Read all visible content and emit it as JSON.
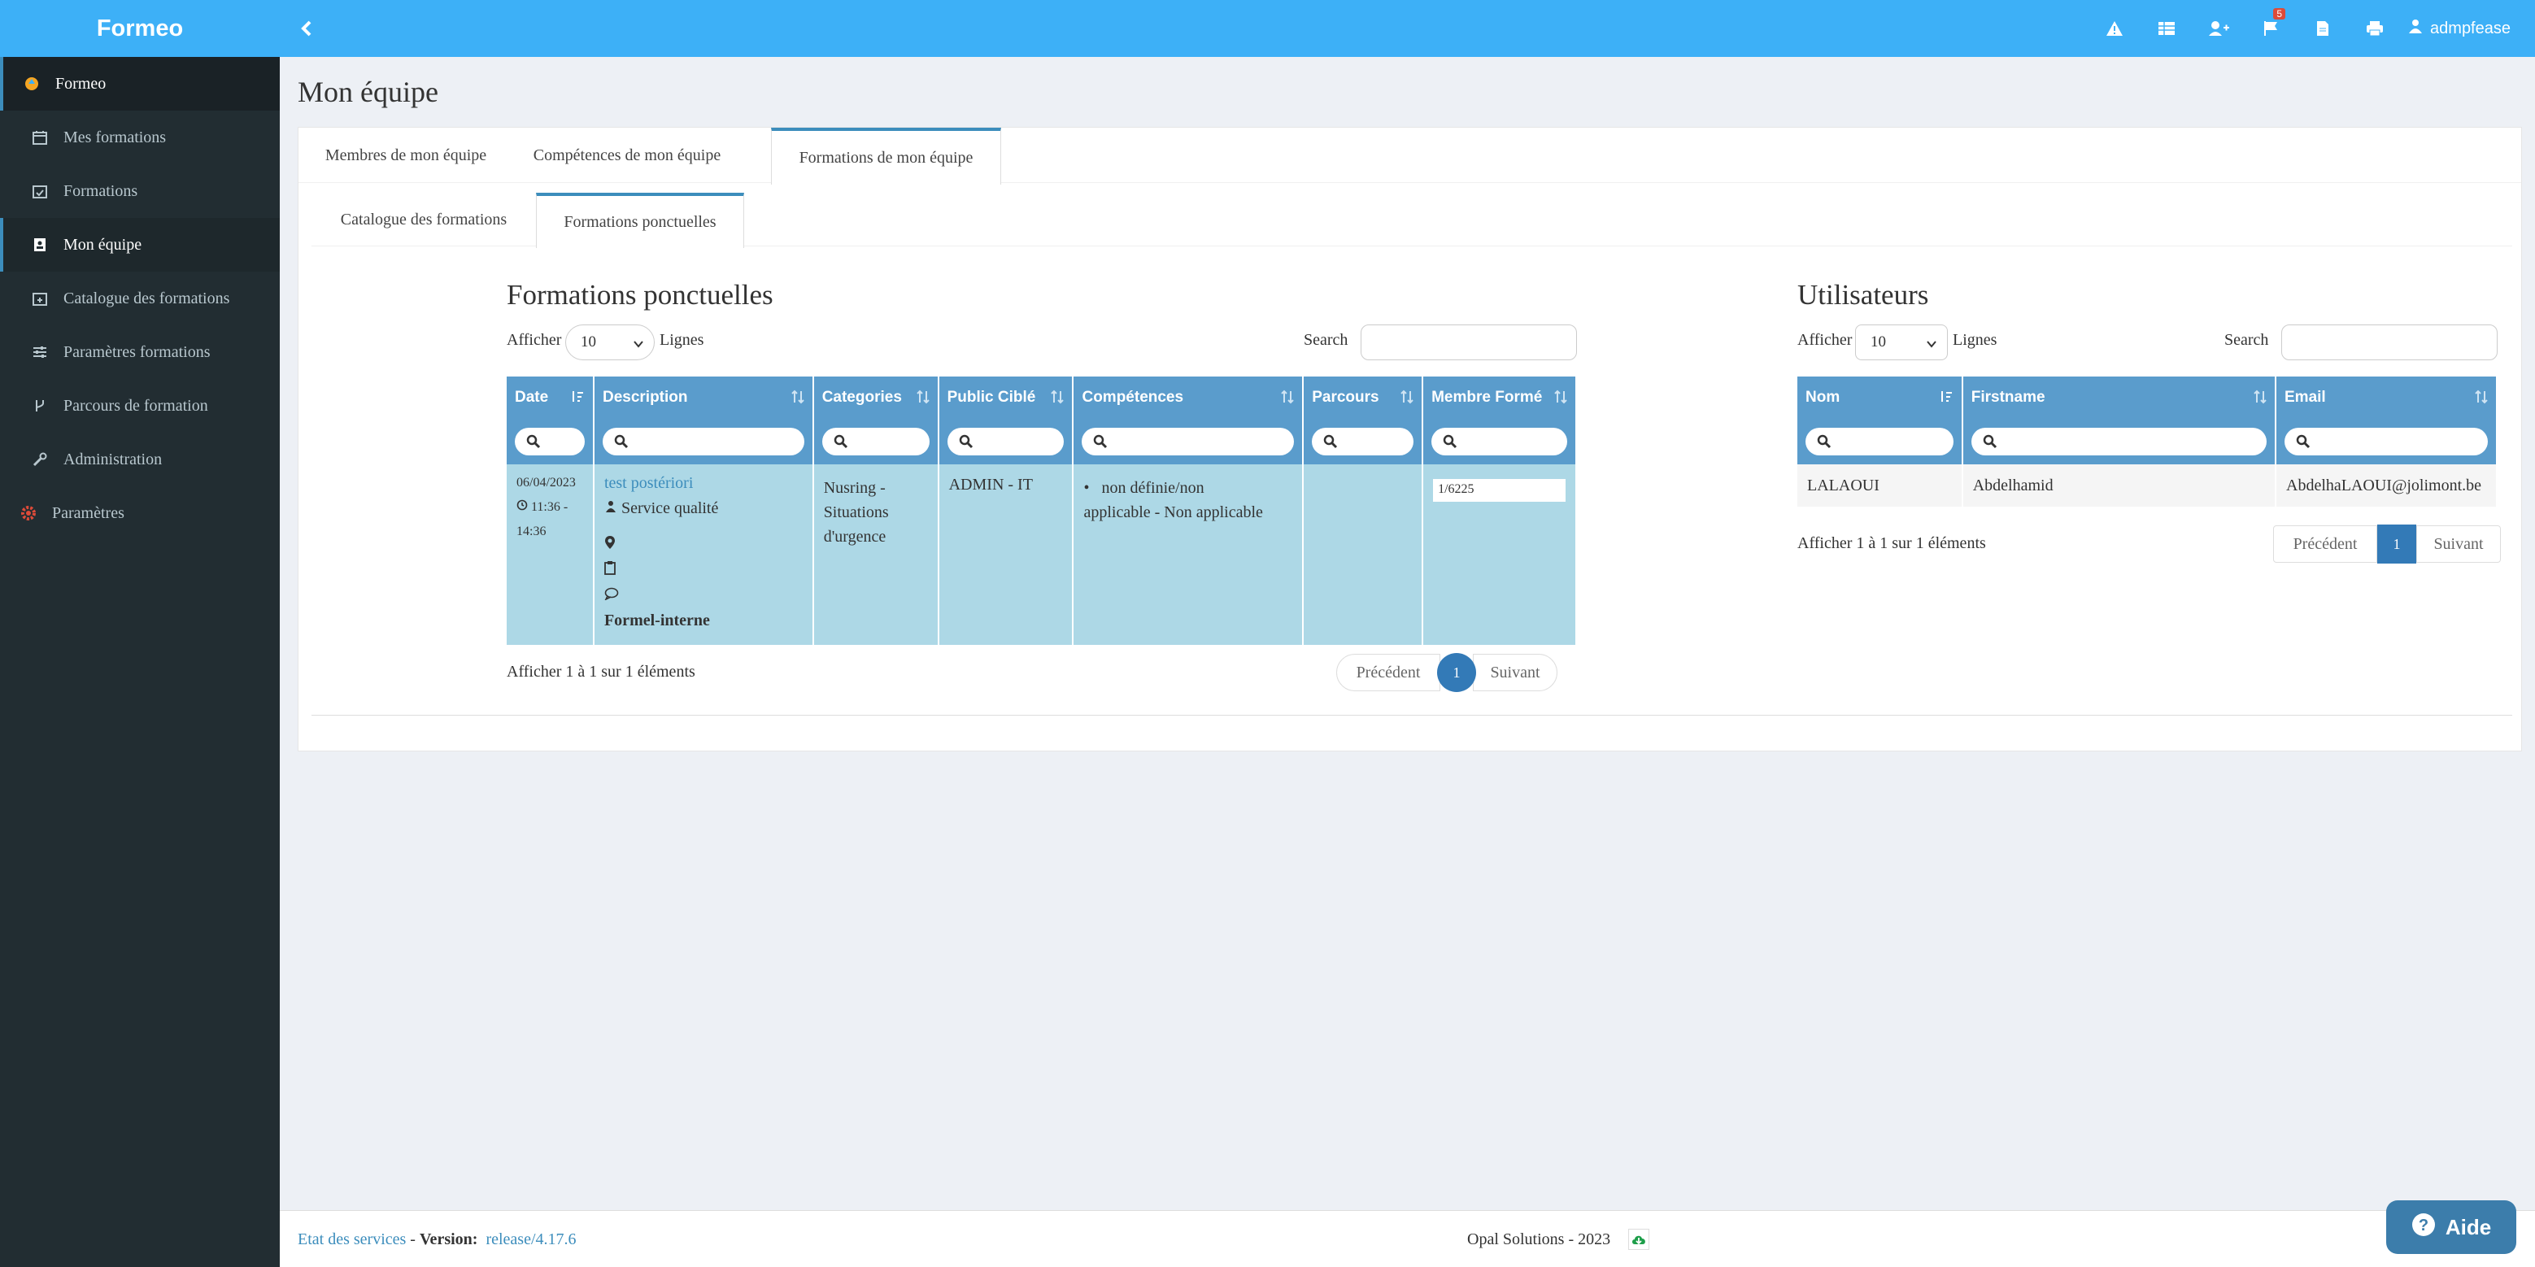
{
  "app": {
    "brand": "Formeo"
  },
  "sidebar": {
    "items": [
      {
        "label": "Formeo",
        "icon": "formeo-logo-icon"
      },
      {
        "label": "Mes formations",
        "icon": "calendar-icon"
      },
      {
        "label": "Formations",
        "icon": "calendar-check-icon"
      },
      {
        "label": "Mon équipe",
        "icon": "contact-book-icon"
      },
      {
        "label": "Catalogue des formations",
        "icon": "calendar-plus-icon"
      },
      {
        "label": "Paramètres formations",
        "icon": "sliders-icon"
      },
      {
        "label": "Parcours de formation",
        "icon": "code-fork-icon"
      },
      {
        "label": "Administration",
        "icon": "wrench-icon"
      },
      {
        "label": "Paramètres",
        "icon": "cogs-icon"
      }
    ]
  },
  "topbar": {
    "notifications_count": "5",
    "username": "admpfease",
    "icons": [
      "warning-icon",
      "table-icon",
      "user-plus-icon",
      "flag-icon",
      "file-icon",
      "print-icon",
      "user-icon"
    ]
  },
  "page": {
    "title": "Mon équipe"
  },
  "tabs": [
    "Membres de mon équipe",
    "Compétences de mon équipe",
    "Formations de mon équipe"
  ],
  "subtabs": [
    "Catalogue des formations",
    "Formations ponctuelles"
  ],
  "left_table": {
    "title": "Formations ponctuelles",
    "show_label": "Afficher",
    "lines_label": "Lignes",
    "page_size": "10",
    "search_label": "Search",
    "columns": [
      "Date",
      "Description",
      "Categories",
      "Public Ciblé",
      "Compétences",
      "Parcours",
      "Membre Formé"
    ],
    "row": {
      "date": "06/04/2023",
      "time_start": "11:36 -",
      "time_end": "14:36",
      "title": "test postériori",
      "service": "Service qualité",
      "type": "Formel-interne",
      "categories_1": "Nusring -",
      "categories_2": "Situations",
      "categories_3": "d'urgence",
      "public": "ADMIN - IT",
      "competence_1": "non définie/non",
      "competence_2": "applicable - Non applicable",
      "parcours": "",
      "membre": "1/6225"
    },
    "info": "Afficher 1 à 1 sur 1 éléments",
    "prev": "Précédent",
    "page": "1",
    "next": "Suivant"
  },
  "right_table": {
    "title": "Utilisateurs",
    "show_label": "Afficher",
    "lines_label": "Lignes",
    "page_size": "10",
    "search_label": "Search",
    "columns": [
      "Nom",
      "Firstname",
      "Email"
    ],
    "row": {
      "nom": "LALAOUI",
      "firstname": "Abdelhamid",
      "email": "AbdelhaLAOUI@jolimont.be"
    },
    "info": "Afficher 1 à 1 sur 1 éléments",
    "prev": "Précédent",
    "page": "1",
    "next": "Suivant"
  },
  "footer": {
    "services_link": "Etat des services",
    "sep": " - ",
    "version_label": "Version:",
    "version": "release/4.17.6",
    "company": "Opal Solutions - 2023"
  },
  "help": {
    "label": "Aide"
  },
  "colors": {
    "primary": "#3db0f7",
    "sidebar": "#222d32",
    "table_header": "#5a9ccc",
    "row_highlight": "#add8e6",
    "link": "#3c8dbc"
  }
}
